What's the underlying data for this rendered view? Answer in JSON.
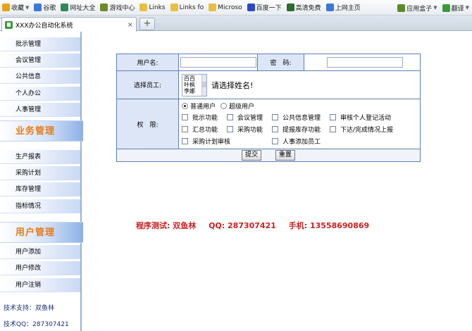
{
  "bookmarks": {
    "items": [
      {
        "label": "收藏",
        "color": "#e8a21a",
        "caret": true
      },
      {
        "label": "谷歌",
        "color": "#3b79d8"
      },
      {
        "label": "网址大全",
        "color": "#2e8b57"
      },
      {
        "label": "游戏中心",
        "color": "#6a8a2a"
      },
      {
        "label": "Links",
        "color": "#e8c040"
      },
      {
        "label": "Links fo",
        "color": "#e8c040"
      },
      {
        "label": "Microso",
        "color": "#e8c040"
      },
      {
        "label": "百度一下",
        "color": "#2a4ac8"
      },
      {
        "label": "高清免费",
        "color": "#2a6a2a"
      },
      {
        "label": "上网主页",
        "color": "#3b79d8"
      }
    ],
    "right": [
      {
        "label": "应用盒子",
        "color": "#5a8a2a",
        "caret": true
      },
      {
        "label": "翻译",
        "color": "#3a9a3a",
        "caret": true
      }
    ]
  },
  "tab": {
    "title": "XXX办公自动化系统",
    "close": "×",
    "new_tab": "+"
  },
  "sidebar": {
    "items_top": [
      "批示管理",
      "会议管理",
      "公共信息",
      "个人办公",
      "人事管理"
    ],
    "head1": "业务管理",
    "items_mid": [
      "生产报表",
      "采购计划",
      "库存管理",
      "指标情况"
    ],
    "head2": "用户管理",
    "items_bot": [
      "用户添加",
      "用户修改",
      "用户注销"
    ],
    "footer_support": "技术支持：双鱼林",
    "footer_qq": "技术QQ：287307421"
  },
  "form": {
    "username_label": "用户名:",
    "username_value": "",
    "password_label": "密　码:",
    "password_value": "",
    "employee_label": "选择员工:",
    "employee_names": [
      "百百",
      "叶枫",
      "李娜"
    ],
    "employee_hint": "请选择姓名!",
    "perm_label": "权　限:",
    "role_normal": "普通用户",
    "role_super": "超级用户",
    "permissions": [
      "批示功能",
      "会议管理",
      "公共信息管理",
      "审核个人登记活动",
      "汇总功能",
      "采购功能",
      "提报库存功能",
      "下达/完成情况上报",
      "采购计划审核",
      "人事添加员工"
    ],
    "submit": "提交",
    "reset": "重置"
  },
  "contact": {
    "tester": "程序测试: 双鱼林",
    "qq": "QQ: 287307421",
    "phone": "手机: 13558690869"
  }
}
